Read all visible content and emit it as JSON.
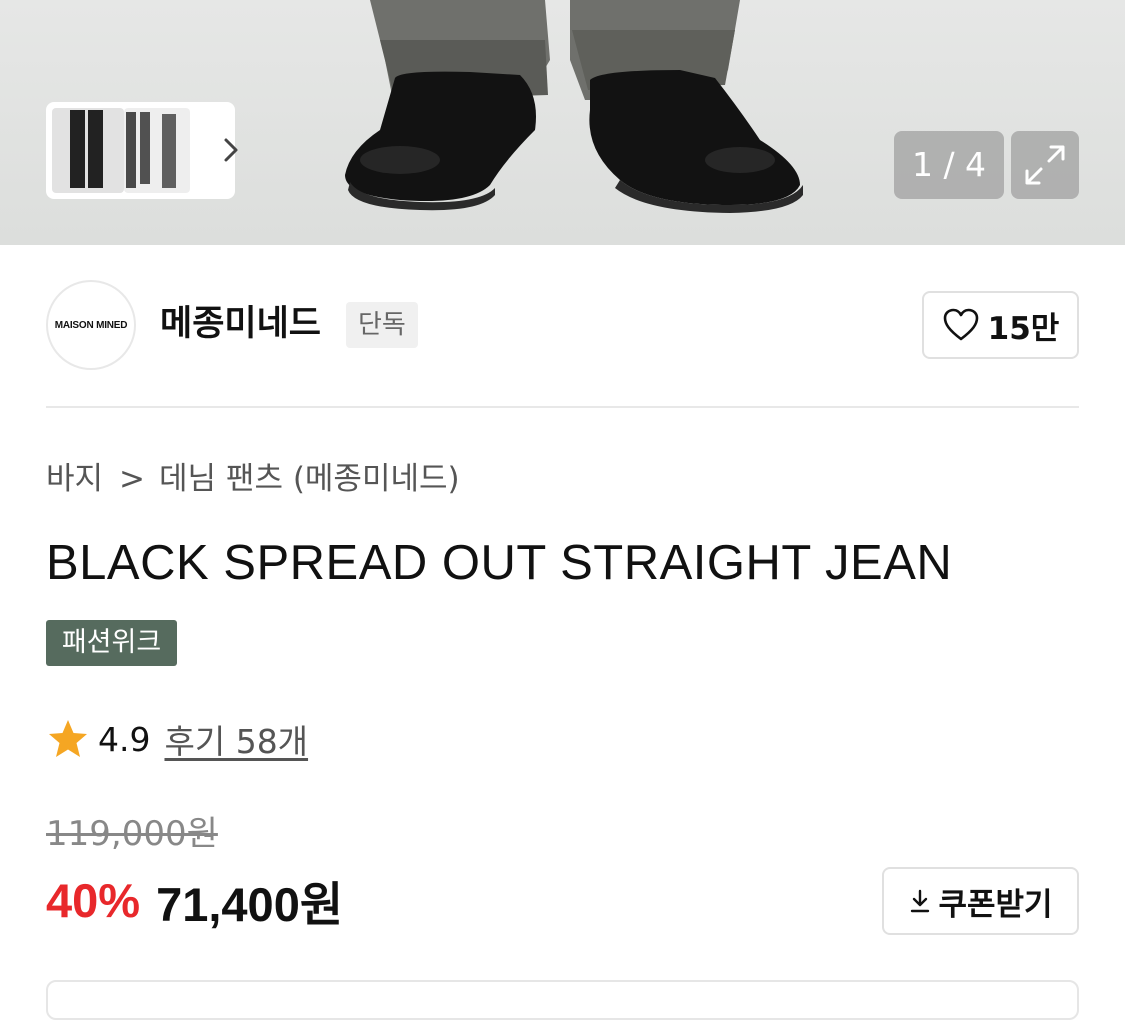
{
  "gallery": {
    "counter": "1 / 4",
    "icons": [
      "chevron-right-icon",
      "expand-icon"
    ]
  },
  "brand": {
    "logo_text": "MAISON MINED",
    "name": "메종미네드",
    "badge": "단독",
    "like_count": "15만"
  },
  "breadcrumb": {
    "items": [
      "바지",
      "데님 팬츠 (메종미네드)"
    ]
  },
  "product": {
    "title": "BLACK SPREAD OUT STRAIGHT JEAN",
    "tag": "패션위크",
    "rating": "4.9",
    "reviews": "후기 58개",
    "original_price": "119,000원",
    "discount": "40%",
    "sale_price": "71,400원",
    "coupon_label": "쿠폰받기"
  },
  "colors": {
    "discount": "#e8282b",
    "tag_bg": "#566b5e",
    "star": "#f5a623"
  }
}
